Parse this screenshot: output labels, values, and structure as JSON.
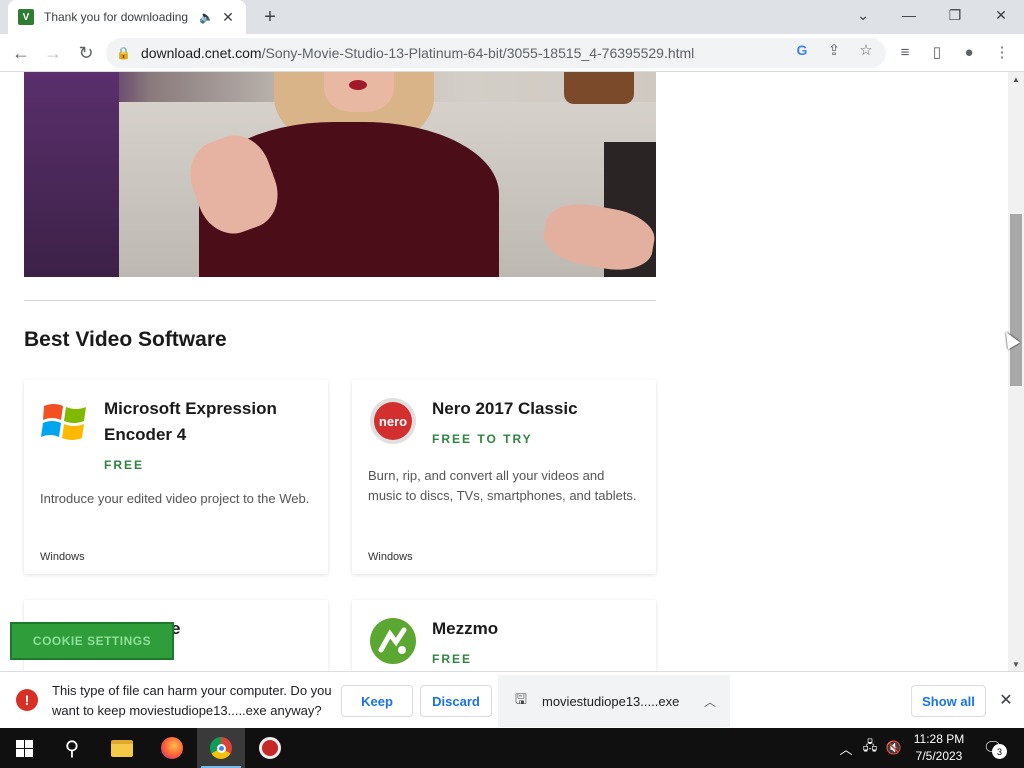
{
  "browser": {
    "tab": {
      "title": "Thank you for downloading",
      "favicon_letter": "V"
    },
    "new_tab_symbol": "+",
    "window_controls": {
      "dropdown": "⌄",
      "minimize": "—",
      "restore": "❐",
      "close": "✕"
    },
    "nav": {
      "back": "←",
      "forward": "→",
      "reload": "↻"
    },
    "address": {
      "domain": "download.cnet.com",
      "path": "/Sony-Movie-Studio-13-Platinum-64-bit/3055-18515_4-76395529.html"
    }
  },
  "page": {
    "section_title": "Best Video Software",
    "cards": [
      {
        "name": "Microsoft Expression Encoder 4",
        "price": "FREE",
        "description": "Introduce your edited video project to the Web.",
        "os": "Windows",
        "logo": "windows-flag-logo"
      },
      {
        "name": "Nero 2017 Classic",
        "price": "FREE TO TRY",
        "description": "Burn, rip, and convert all your videos and music to discs, TVs, smartphones, and tablets.",
        "os": "Windows",
        "logo": "nero-logo"
      },
      {
        "name": "FlixClone",
        "logo": "flixclone-logo"
      },
      {
        "name": "Mezzmo",
        "price": "FREE",
        "logo": "mezzmo-logo"
      }
    ],
    "cookie_button": "COOKIE SETTINGS"
  },
  "download_bar": {
    "warning": "This type of file can harm your computer. Do you want to keep moviestudiope13.....exe anyway?",
    "keep_label": "Keep",
    "discard_label": "Discard",
    "file_name": "moviestudiope13.....exe",
    "show_all_label": "Show all"
  },
  "taskbar": {
    "time": "11:28 PM",
    "date": "7/5/2023",
    "notification_count": "3"
  },
  "colors": {
    "price_green": "#2e8540",
    "cookie_green": "#2e9d3a",
    "warning_red": "#d93025",
    "link_blue": "#1a73e8"
  }
}
